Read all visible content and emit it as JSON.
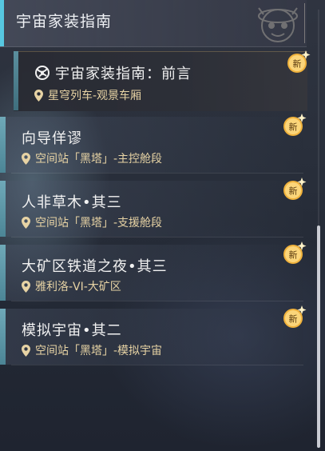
{
  "header": {
    "title": "宇宙家装指南",
    "mascot_icon": "pom-pom-icon"
  },
  "selected_quest": {
    "title": "宇宙家装指南：前言",
    "location": "星穹列车-观景车厢",
    "badge": "新",
    "icon": "quest-icon"
  },
  "quests": [
    {
      "title": "向导佯谬",
      "location": "空间站「黑塔」-主控舱段",
      "badge": "新"
    },
    {
      "title": "人非草木•其三",
      "location": "空间站「黑塔」-支援舱段",
      "badge": "新"
    },
    {
      "title": "大矿区铁道之夜•其三",
      "location": "雅利洛-VI-大矿区",
      "badge": "新"
    },
    {
      "title": "模拟宇宙•其二",
      "location": "空间站「黑塔」-模拟宇宙",
      "badge": "新"
    }
  ],
  "colors": {
    "accent": "#57c7e0",
    "location_text": "#e7d3a4",
    "badge_gold": "#f0b23c"
  }
}
